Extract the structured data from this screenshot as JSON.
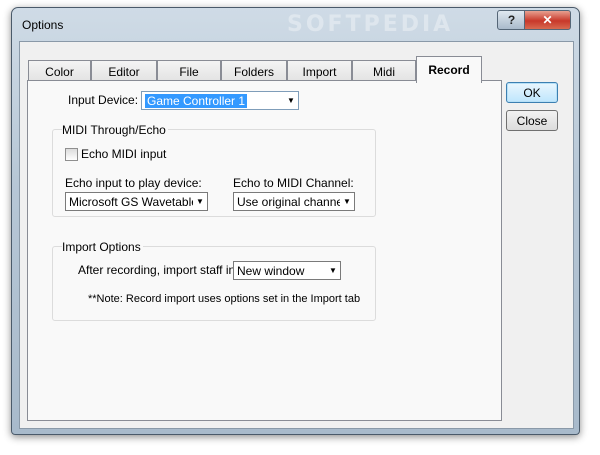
{
  "window": {
    "title": "Options",
    "watermark": "SOFTPEDIA",
    "help_glyph": "?",
    "close_glyph": "✕"
  },
  "tabs": [
    {
      "label": "Color"
    },
    {
      "label": "Editor"
    },
    {
      "label": "File"
    },
    {
      "label": "Folders"
    },
    {
      "label": "Import"
    },
    {
      "label": "Midi"
    },
    {
      "label": "Record"
    }
  ],
  "active_tab": "Record",
  "input_device": {
    "label": "Input Device:",
    "value": "Game Controller 1"
  },
  "midi_through": {
    "title": "MIDI Through/Echo",
    "echo_checkbox_label": "Echo MIDI input",
    "echo_checked": false,
    "play_device_label": "Echo input to play device:",
    "play_device_value": "Microsoft GS Wavetable",
    "channel_label": "Echo to MIDI Channel:",
    "channel_value": "Use original channel"
  },
  "import_options": {
    "title": "Import Options",
    "staff_label": "After recording, import staff into:",
    "staff_value": "New window",
    "note": "**Note: Record import uses options set in the Import tab"
  },
  "buttons": {
    "ok": "OK",
    "close": "Close"
  },
  "colors": {
    "selection": "#3399ff",
    "close_button": "#c8382a"
  }
}
